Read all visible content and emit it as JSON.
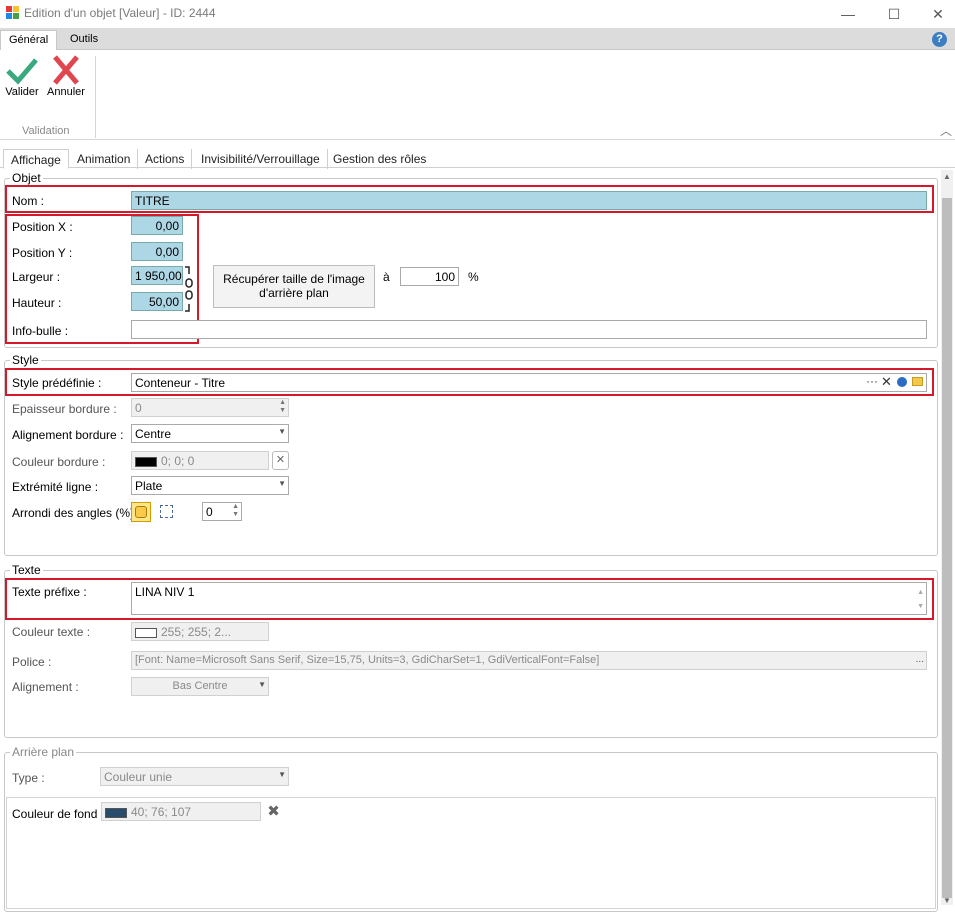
{
  "window": {
    "title": "Edition d'un objet [Valeur] - ID: 2444",
    "minimize": "—",
    "maximize": "☐",
    "close": "✕"
  },
  "ribbon": {
    "tabs": [
      "Général",
      "Outils"
    ],
    "help": "?",
    "validate_label": "Valider",
    "cancel_label": "Annuler",
    "group_label": "Validation",
    "collapse": "︿"
  },
  "tabs": [
    "Affichage",
    "Animation",
    "Actions",
    "Invisibilité/Verrouillage",
    "Gestion des rôles"
  ],
  "objet": {
    "title": "Objet",
    "nom_label": "Nom :",
    "nom_value": "TITRE",
    "posx_label": "Position X :",
    "posx_value": "0,00",
    "posy_label": "Position Y :",
    "posy_value": "0,00",
    "largeur_label": "Largeur :",
    "largeur_value": "1 950,00",
    "hauteur_label": "Hauteur :",
    "hauteur_value": "50,00",
    "infobulle_label": "Info-bulle :",
    "infobulle_value": "",
    "recup_button": "Récupérer taille de l'image d'arrière plan",
    "a_label": "à",
    "percent_value": "100",
    "percent_sign": "%"
  },
  "style": {
    "title": "Style",
    "predef_label": "Style prédéfinie :",
    "predef_value": "Conteneur - Titre",
    "epaisseur_label": "Epaisseur bordure :",
    "epaisseur_value": "0",
    "alignement_label": "Alignement bordure :",
    "alignement_value": "Centre",
    "couleur_label": "Couleur bordure :",
    "couleur_value": "0; 0; 0",
    "couleur_hex": "#000000",
    "extremite_label": "Extrémité ligne :",
    "extremite_value": "Plate",
    "arrondi_label": "Arrondi des angles (%) :",
    "arrondi_value": "0"
  },
  "texte": {
    "title": "Texte",
    "prefixe_label": "Texte préfixe :",
    "prefixe_value": "LINA NIV 1",
    "couleur_label": "Couleur texte :",
    "couleur_value": "255; 255; 2...",
    "couleur_hex": "#ffffff",
    "police_label": "Police :",
    "police_value": "[Font: Name=Microsoft Sans Serif, Size=15,75, Units=3, GdiCharSet=1, GdiVerticalFont=False]",
    "alignement_label": "Alignement :",
    "alignement_value": "Bas Centre"
  },
  "arriere": {
    "title": "Arrière plan",
    "type_label": "Type :",
    "type_value": "Couleur unie",
    "fond_label": "Couleur de fond :",
    "fond_value": "40; 76; 107",
    "fond_hex": "#284c6b"
  },
  "colors": {
    "highlight": "#d41a2a",
    "field_blue": "#aed7e6"
  }
}
